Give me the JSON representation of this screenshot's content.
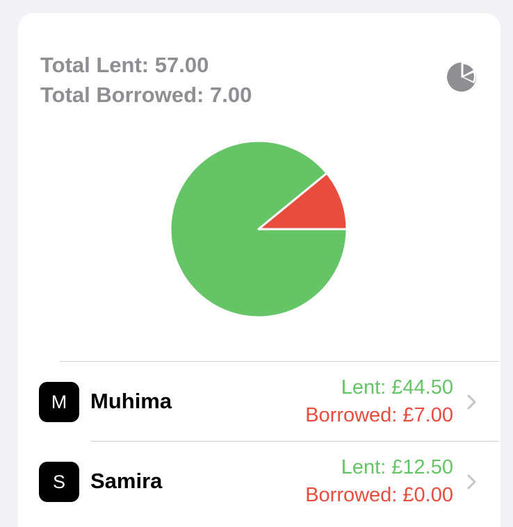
{
  "colors": {
    "lent": "#65c466",
    "borrowed": "#e84c3d",
    "muted": "#8e8e93"
  },
  "summary": {
    "total_lent_label": "Total Lent: 57.00",
    "total_borrowed_label": "Total Borrowed: 7.00",
    "chart_icon": "pie-chart-icon"
  },
  "chart_data": {
    "type": "pie",
    "slices": [
      {
        "value": 57.0,
        "color": "#65c466"
      },
      {
        "value": 7.0,
        "color": "#e84c3d"
      }
    ]
  },
  "people": [
    {
      "initial": "M",
      "name": "Muhima",
      "lent": "Lent: £44.50",
      "borrowed": "Borrowed: £7.00"
    },
    {
      "initial": "S",
      "name": "Samira",
      "lent": "Lent: £12.50",
      "borrowed": "Borrowed: £0.00"
    }
  ]
}
